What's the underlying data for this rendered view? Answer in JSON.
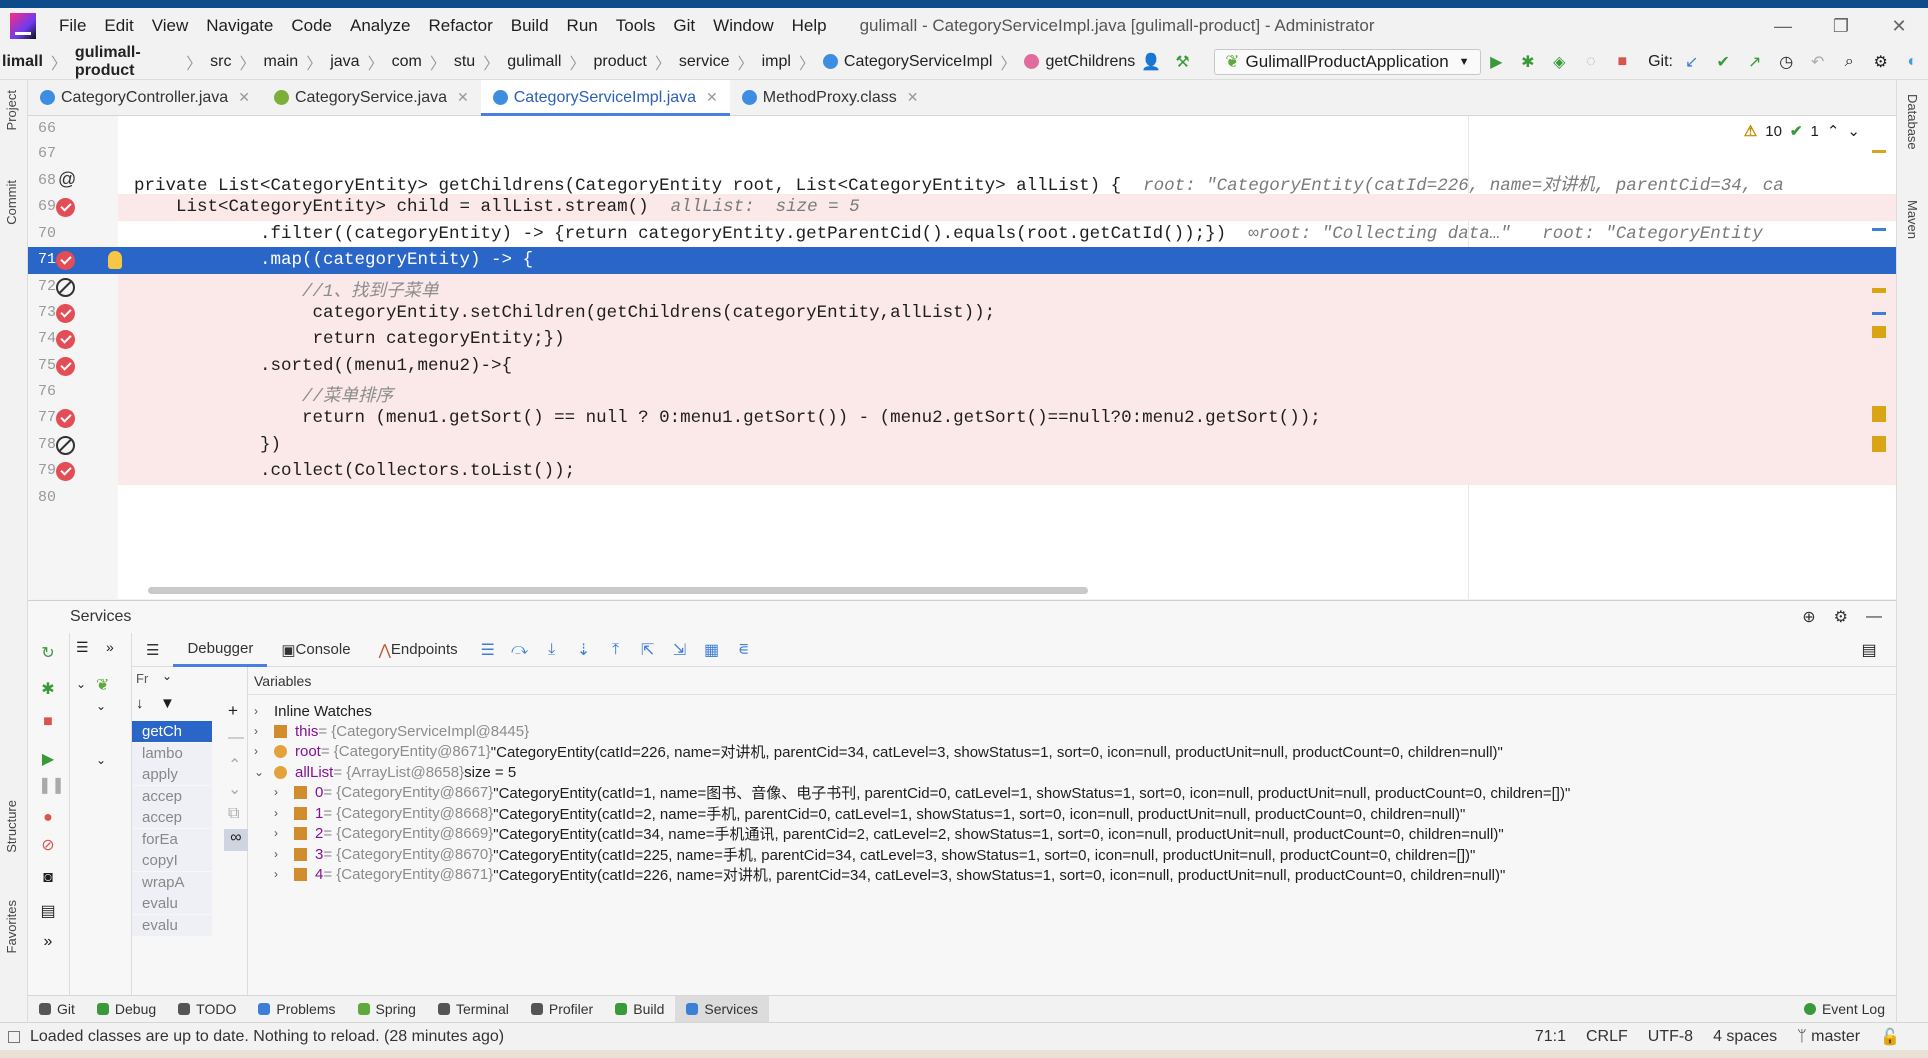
{
  "window": {
    "title": "gulimall - CategoryServiceImpl.java [gulimall-product] - Administrator",
    "menus": [
      "File",
      "Edit",
      "View",
      "Navigate",
      "Code",
      "Analyze",
      "Refactor",
      "Build",
      "Run",
      "Tools",
      "Git",
      "Window",
      "Help"
    ]
  },
  "navbar": {
    "crumbs": [
      "limall",
      "gulimall-product",
      "src",
      "main",
      "java",
      "com",
      "stu",
      "gulimall",
      "product",
      "service",
      "impl",
      "CategoryServiceImpl",
      "getChildrens"
    ],
    "run_config": "GulimallProductApplication",
    "git_label": "Git:"
  },
  "tabs": [
    {
      "label": "CategoryController.java",
      "color": "#3d8ee0"
    },
    {
      "label": "CategoryService.java",
      "color": "#7cae3a"
    },
    {
      "label": "CategoryServiceImpl.java",
      "color": "#3d8ee0"
    },
    {
      "label": "MethodProxy.class",
      "color": "#3d8ee0"
    }
  ],
  "editor": {
    "problems": {
      "warnings": "10",
      "ok": "1"
    },
    "lines": [
      {
        "n": "66",
        "marker": "none",
        "style": "plain",
        "t1": "",
        "t2": ""
      },
      {
        "n": "67",
        "marker": "none",
        "style": "plain",
        "t1": "",
        "t2": ""
      },
      {
        "n": "68",
        "marker": "at",
        "style": "plain",
        "t1": "private List<CategoryEntity> getChildrens(CategoryEntity root, List<CategoryEntity> allList) {",
        "t2": "root: \"CategoryEntity(catId=226, name=对讲机, parentCid=34, ca"
      },
      {
        "n": "69",
        "marker": "bp",
        "style": "hl",
        "t1": "    List<CategoryEntity> child = allList.stream()",
        "t2": "allList:  size = 5"
      },
      {
        "n": "70",
        "marker": "none",
        "style": "plain",
        "t1": "            .filter((categoryEntity) -> {return categoryEntity.getParentCid().equals(root.getCatId());})",
        "t2": "∞root: \"Collecting data…\"   root: \"CategoryEntity"
      },
      {
        "n": "71",
        "marker": "bp",
        "style": "cur",
        "t1": "            .map((categoryEntity) -> {",
        "t2": ""
      },
      {
        "n": "72",
        "marker": "no",
        "style": "hl",
        "t1": "                //1、找到子菜单",
        "t2": ""
      },
      {
        "n": "73",
        "marker": "bp",
        "style": "hl",
        "t1": "                 categoryEntity.setChildren(getChildrens(categoryEntity,allList));",
        "t2": ""
      },
      {
        "n": "74",
        "marker": "bp",
        "style": "hl",
        "t1": "                 return categoryEntity;})",
        "t2": ""
      },
      {
        "n": "75",
        "marker": "bp",
        "style": "hl",
        "t1": "            .sorted((menu1,menu2)->{",
        "t2": ""
      },
      {
        "n": "76",
        "marker": "none",
        "style": "hl",
        "t1": "                //菜单排序",
        "t2": ""
      },
      {
        "n": "77",
        "marker": "bp",
        "style": "hl",
        "t1": "                return (menu1.getSort() == null ? 0:menu1.getSort()) - (menu2.getSort()==null?0:menu2.getSort());",
        "t2": ""
      },
      {
        "n": "78",
        "marker": "no",
        "style": "hl",
        "t1": "            })",
        "t2": ""
      },
      {
        "n": "79",
        "marker": "bp",
        "style": "hl",
        "t1": "            .collect(Collectors.toList());",
        "t2": ""
      },
      {
        "n": "80",
        "marker": "none",
        "style": "plain",
        "t1": "",
        "t2": ""
      }
    ]
  },
  "services": {
    "title": "Services",
    "debug_tabs": [
      "Debugger",
      "Console",
      "Endpoints"
    ],
    "frames_label": "Fr",
    "variables_label": "Variables",
    "frames": [
      "getCh",
      "lambo",
      "apply",
      "accep",
      "accep",
      "forEa",
      "copyI",
      "wrapA",
      "evalu",
      "evalu"
    ],
    "vars": [
      {
        "indent": 0,
        "chev": "›",
        "icon": "none",
        "name": "Inline Watches",
        "ref": "",
        "val": ""
      },
      {
        "indent": 0,
        "chev": "›",
        "icon": "field",
        "name": "this",
        "ref": " = {CategoryServiceImpl@8445}",
        "val": ""
      },
      {
        "indent": 0,
        "chev": "›",
        "icon": "param",
        "name": "root",
        "ref": " = {CategoryEntity@8671}",
        "val": " \"CategoryEntity(catId=226, name=对讲机, parentCid=34, catLevel=3, showStatus=1, sort=0, icon=null, productUnit=null, productCount=0, children=null)\""
      },
      {
        "indent": 0,
        "chev": "⌄",
        "icon": "param",
        "name": "allList",
        "ref": " = {ArrayList@8658}",
        "val": "  size = 5"
      },
      {
        "indent": 1,
        "chev": "›",
        "icon": "field",
        "name": "0",
        "ref": " = {CategoryEntity@8667}",
        "val": " \"CategoryEntity(catId=1, name=图书、音像、电子书刊, parentCid=0, catLevel=1, showStatus=1, sort=0, icon=null, productUnit=null, productCount=0, children=[])\""
      },
      {
        "indent": 1,
        "chev": "›",
        "icon": "field",
        "name": "1",
        "ref": " = {CategoryEntity@8668}",
        "val": " \"CategoryEntity(catId=2, name=手机, parentCid=0, catLevel=1, showStatus=1, sort=0, icon=null, productUnit=null, productCount=0, children=null)\""
      },
      {
        "indent": 1,
        "chev": "›",
        "icon": "field",
        "name": "2",
        "ref": " = {CategoryEntity@8669}",
        "val": " \"CategoryEntity(catId=34, name=手机通讯, parentCid=2, catLevel=2, showStatus=1, sort=0, icon=null, productUnit=null, productCount=0, children=null)\""
      },
      {
        "indent": 1,
        "chev": "›",
        "icon": "field",
        "name": "3",
        "ref": " = {CategoryEntity@8670}",
        "val": " \"CategoryEntity(catId=225, name=手机, parentCid=34, catLevel=3, showStatus=1, sort=0, icon=null, productUnit=null, productCount=0, children=[])\""
      },
      {
        "indent": 1,
        "chev": "›",
        "icon": "field",
        "name": "4",
        "ref": " = {CategoryEntity@8671}",
        "val": " \"CategoryEntity(catId=226, name=对讲机, parentCid=34, catLevel=3, showStatus=1, sort=0, icon=null, productUnit=null, productCount=0, children=null)\""
      }
    ]
  },
  "bottom_tabs": [
    "Git",
    "Debug",
    "TODO",
    "Problems",
    "Spring",
    "Terminal",
    "Profiler",
    "Build",
    "Services"
  ],
  "event_log": "Event Log",
  "status": {
    "message": "Loaded classes are up to date. Nothing to reload. (28 minutes ago)",
    "position": "71:1",
    "line_sep": "CRLF",
    "encoding": "UTF-8",
    "indent": "4 spaces",
    "branch": "master"
  },
  "side_labels": {
    "project": "Project",
    "commit": "Commit",
    "structure": "Structure",
    "favorites": "Favorites",
    "database": "Database",
    "maven": "Maven"
  },
  "colors": {
    "accent": "#2a65c8",
    "breakpoint": "#e24d56",
    "exec_line": "#fbe8e8"
  }
}
